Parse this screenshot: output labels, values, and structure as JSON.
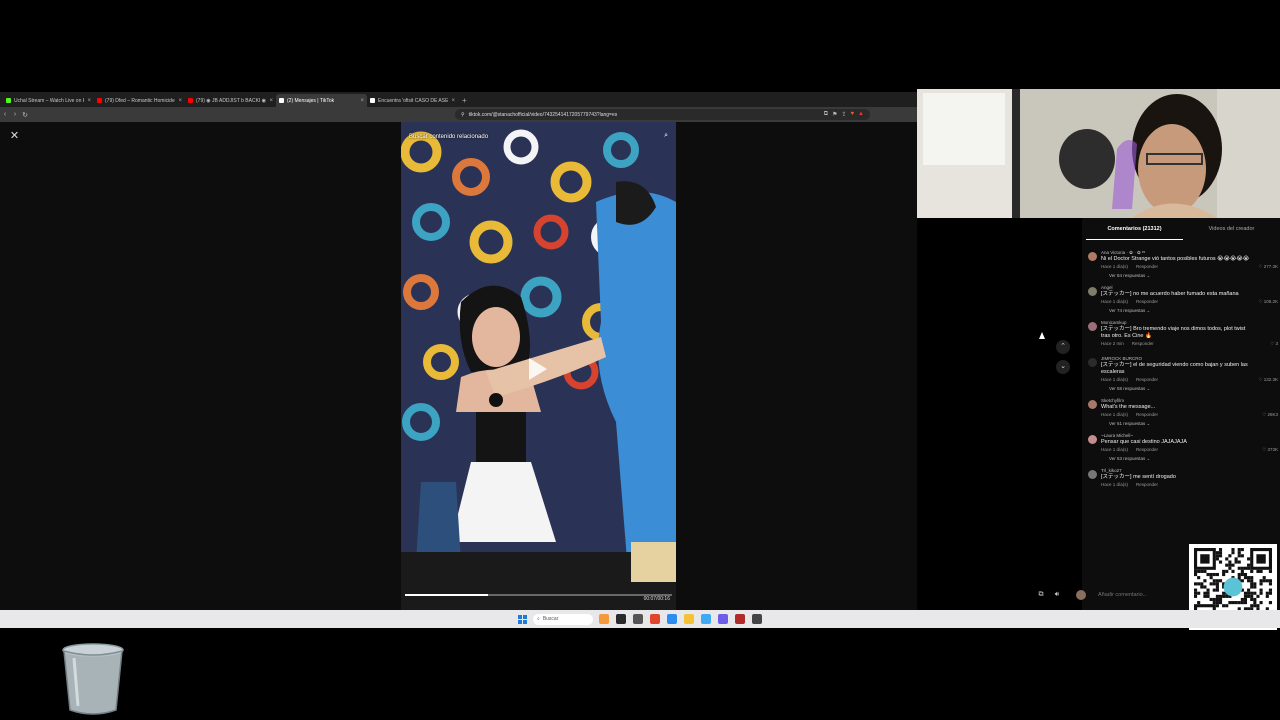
{
  "browser": {
    "tabs": [
      {
        "label": "Uchal Stream – Watch Live on Ki",
        "icon_color": "#53fc18",
        "active": false
      },
      {
        "label": "(79) Dfed – Romantic Homicide ; S",
        "icon_color": "#ff0000",
        "active": false
      },
      {
        "label": "(79) ◉ JB ADDJIST b BACKI ◉ Di",
        "icon_color": "#ff0000",
        "active": false
      },
      {
        "label": "(2) Mensajes | TikTok",
        "icon_color": "#ffffff",
        "active": true
      },
      {
        "label": "Encuentra 'ofisit CASO DE ASESINO",
        "icon_color": "#ffffff",
        "active": false
      }
    ],
    "tab_close": "×",
    "new_tab": "+",
    "url": "tiktok.com/@stanachofficial/video/7432541417205779743?lang=es"
  },
  "video": {
    "related_label": "Buscar contenido relacionado",
    "time_label": "00:07/00:16",
    "progress": 0.31
  },
  "comments_panel": {
    "tabs": [
      {
        "label": "Comentarios (21312)",
        "active": true
      },
      {
        "label": "Videos del creador",
        "active": false
      }
    ],
    "reply_label": "Responder",
    "items": [
      {
        "user": "Ana Victoria · ✿ · ✿ ᵉˢ",
        "text": "Ni el Doctor Strange vió tantos posibles futuros 😭😭😭😭😭",
        "time": "Hace 1 día(s)",
        "likes": "277.3K",
        "replies": "Ver 84 respuestas ⌄",
        "avatar_color": "#b07a66"
      },
      {
        "user": "Angel",
        "text": "[ステッカー] no me acuerdo haber fumado esta mañana",
        "time": "Hace 1 día(s)",
        "likes": "108.2K",
        "replies": "Ver 74 respuestas ⌄",
        "avatar_color": "#7d7d6a"
      },
      {
        "user": "Monicamkup",
        "text": "[ステッカー] Bro tremendo viaje nos dimos todos, plot twist tras otro. Es Cine 🔥",
        "time": "Hace 2 min",
        "likes": "3",
        "replies": "",
        "avatar_color": "#9b6f7a"
      },
      {
        "user": "JIMROCK BURCRO",
        "text": "[ステッカー] el de seguridad viendo como bajan y suben las escaleras",
        "time": "Hace 1 día(s)",
        "likes": "132.3K",
        "replies": "Ver 58 respuestas ⌄",
        "avatar_color": "#2b2b2b"
      },
      {
        "user": "Sketchyfilm",
        "text": "What's the message...",
        "time": "Hace 1 día(s)",
        "likes": "28K3",
        "replies": "Ver 61 respuestas ⌄",
        "avatar_color": "#a8776a"
      },
      {
        "user": "~Laura Michell~",
        "text": "Pensar que casi destino JAJAJAJA",
        "time": "Hace 1 día(s)",
        "likes": "373K",
        "replies": "Ver 53 respuestas ⌄",
        "avatar_color": "#c48d8d"
      },
      {
        "user": "Trl_kiko27",
        "text": "[ステッカー] me sentí drogado",
        "time": "Hace 1 día(s)",
        "likes": "",
        "replies": "",
        "avatar_color": "#777777"
      }
    ],
    "input_placeholder": "Añadir comentario..."
  },
  "taskbar": {
    "search_label": "Buscar",
    "apps": [
      "#f39a3a",
      "#2a2a2a",
      "#555555",
      "#e0452e",
      "#2d8cf0",
      "#f3c237",
      "#3fa9f5",
      "#6c5ce7",
      "#b12b2b",
      "#444444"
    ]
  },
  "colors": {
    "accent": "#fe2c55",
    "panel_bg": "#0d0d0d"
  }
}
